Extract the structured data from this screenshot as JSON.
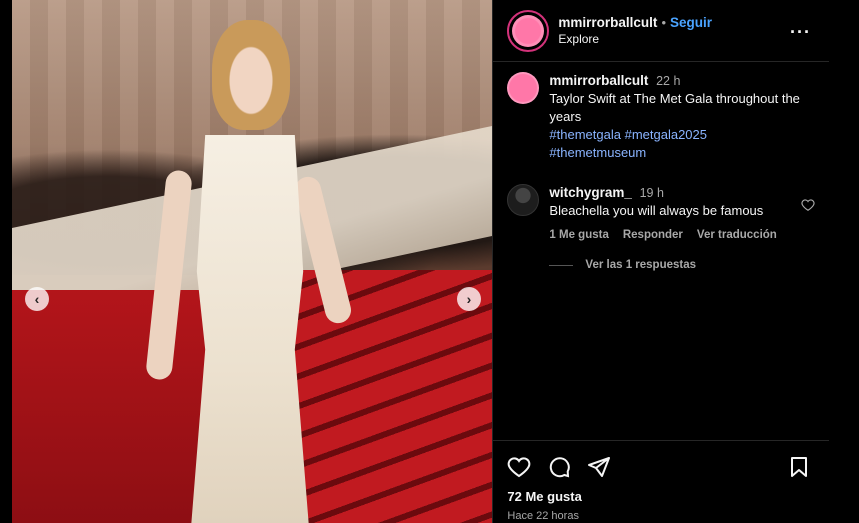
{
  "post": {
    "username": "mmirrorballcult",
    "follow_label": "Seguir",
    "subtitle": "Explore",
    "caption_time": "22 h",
    "caption_line1": "Taylor Swift at The Met Gala throughout the years",
    "hashtags": [
      "#themetgala",
      "#metgala2025",
      "#themetmuseum"
    ]
  },
  "comment": {
    "username": "witchygram_",
    "time": "19 h",
    "text": "Bleachella you will always be famous",
    "likes_label": "1 Me gusta",
    "reply_label": "Responder",
    "translate_label": "Ver traducción",
    "view_replies": "Ver las 1 respuestas"
  },
  "footer": {
    "likes": "72 Me gusta",
    "time_ago": "Hace 22 horas"
  },
  "colors": {
    "link": "#4aa3ff",
    "hashtag": "#8ab4ff",
    "ring": "#d3327a",
    "avatar": "#ff77a8"
  },
  "icons": [
    "heart-icon",
    "comment-icon",
    "share-icon",
    "bookmark-icon",
    "more-icon",
    "chevron-left-icon",
    "chevron-right-icon"
  ]
}
